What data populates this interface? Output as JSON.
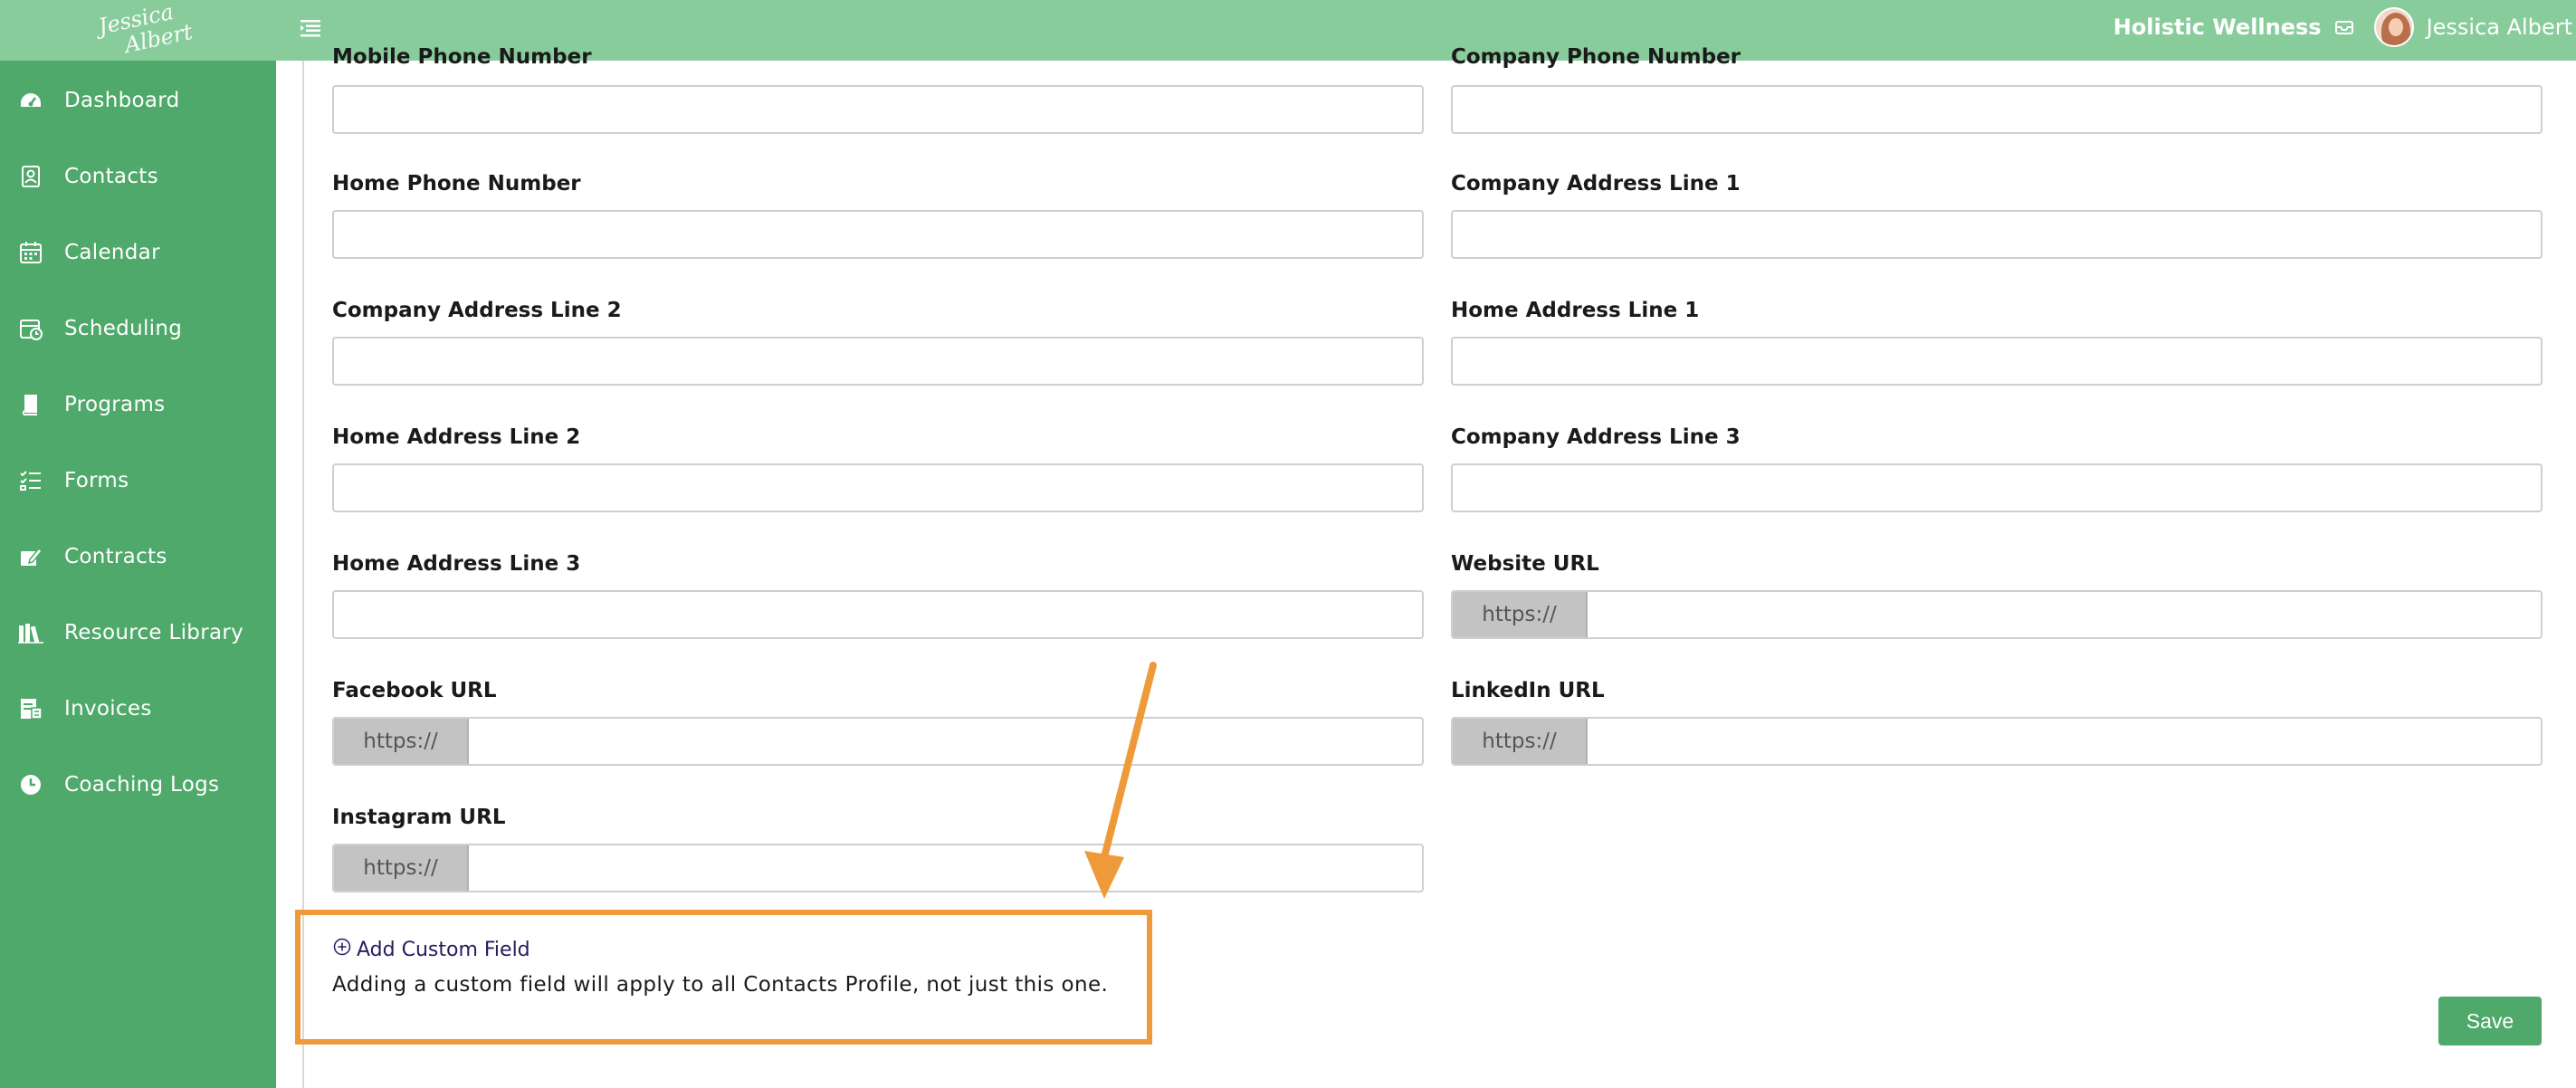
{
  "header": {
    "logo_text_line1": "Jessica",
    "logo_text_line2": "Albert",
    "org_name": "Holistic Wellness",
    "user_name": "Jessica Albert"
  },
  "sidebar": {
    "items": [
      {
        "label": "Dashboard",
        "icon": "dashboard-icon"
      },
      {
        "label": "Contacts",
        "icon": "contacts-icon"
      },
      {
        "label": "Calendar",
        "icon": "calendar-icon"
      },
      {
        "label": "Scheduling",
        "icon": "scheduling-icon"
      },
      {
        "label": "Programs",
        "icon": "programs-icon"
      },
      {
        "label": "Forms",
        "icon": "forms-icon"
      },
      {
        "label": "Contracts",
        "icon": "contracts-icon"
      },
      {
        "label": "Resource Library",
        "icon": "library-icon"
      },
      {
        "label": "Invoices",
        "icon": "invoices-icon"
      },
      {
        "label": "Coaching Logs",
        "icon": "clock-icon"
      }
    ]
  },
  "form": {
    "fields": {
      "mobile_phone": {
        "label": "Mobile Phone Number",
        "value": ""
      },
      "company_phone": {
        "label": "Company Phone Number",
        "value": ""
      },
      "home_phone": {
        "label": "Home Phone Number",
        "value": ""
      },
      "company_address_1": {
        "label": "Company Address Line 1",
        "value": ""
      },
      "company_address_2": {
        "label": "Company Address Line 2",
        "value": ""
      },
      "home_address_1": {
        "label": "Home Address Line 1",
        "value": ""
      },
      "home_address_2": {
        "label": "Home Address Line 2",
        "value": ""
      },
      "company_address_3": {
        "label": "Company Address Line 3",
        "value": ""
      },
      "home_address_3": {
        "label": "Home Address Line 3",
        "value": ""
      },
      "website_url": {
        "label": "Website URL",
        "prefix": "https://",
        "value": ""
      },
      "facebook_url": {
        "label": "Facebook URL",
        "prefix": "https://",
        "value": ""
      },
      "linkedin_url": {
        "label": "LinkedIn URL",
        "prefix": "https://",
        "value": ""
      },
      "instagram_url": {
        "label": "Instagram URL",
        "prefix": "https://",
        "value": ""
      }
    },
    "add_custom_field_label": "Add Custom Field",
    "custom_field_note": "Adding a custom field will apply to all Contacts Profile, not just this one.",
    "save_label": "Save"
  },
  "colors": {
    "topbar": "#88cc9c",
    "sidebar": "#4ea96a",
    "accent_orange": "#ef9a3a",
    "save_button": "#4ea96a"
  }
}
